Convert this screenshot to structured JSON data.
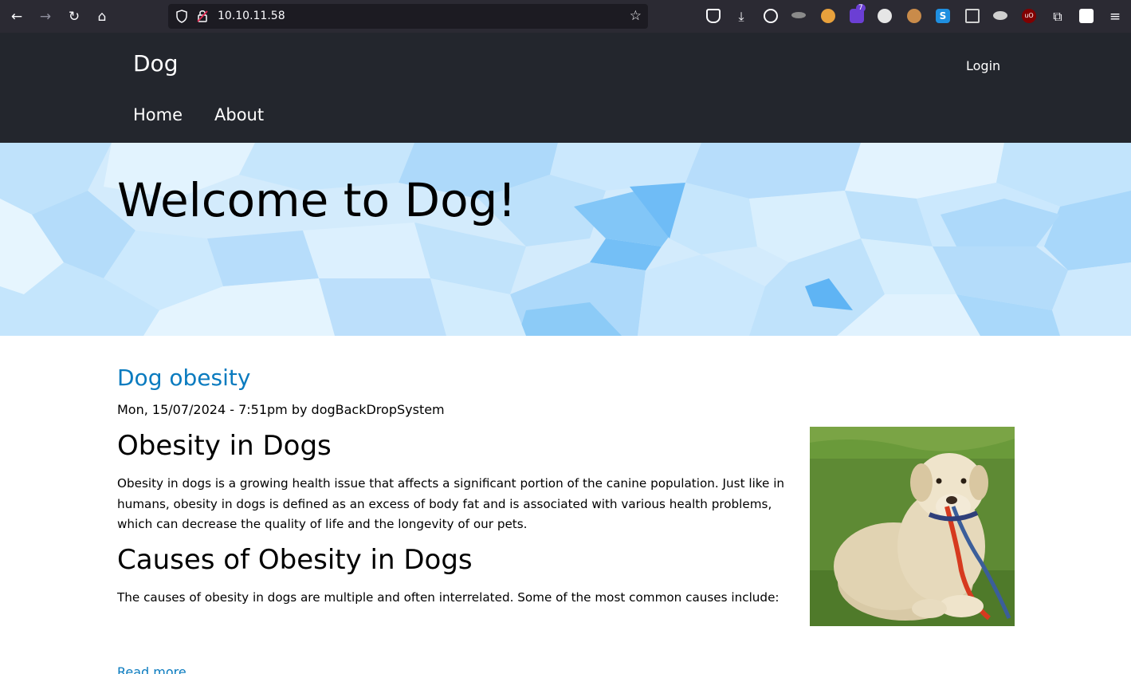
{
  "browser": {
    "url": "10.10.11.58",
    "extension_badge": "7",
    "extension_icons": [
      "pocket-icon",
      "download-icon",
      "account-icon",
      "hat-icon",
      "cookie-jar-icon",
      "puzzle-purple-icon",
      "mask-icon",
      "cookie-icon",
      "s-icon",
      "trash-icon",
      "ufo-icon",
      "ublock-icon",
      "extensions-icon",
      "search-ext-icon",
      "menu-icon"
    ]
  },
  "site": {
    "name": "Dog",
    "login_label": "Login",
    "nav": [
      "Home",
      "About"
    ]
  },
  "hero": {
    "title": "Welcome to Dog!"
  },
  "article": {
    "title": "Dog obesity",
    "meta": "Mon, 15/07/2024 - 7:51pm by dogBackDropSystem",
    "heading_1": "Obesity in Dogs",
    "paragraph_1": "Obesity in dogs is a growing health issue that affects a significant portion of the canine population. Just like in humans, obesity in dogs is defined as an excess of body fat and is associated with various health problems, which can decrease the quality of life and the longevity of our pets.",
    "heading_2": "Causes of Obesity in Dogs",
    "paragraph_2": "The causes of obesity in dogs are multiple and often interrelated. Some of the most common causes include:",
    "read_more": "Read more"
  },
  "colors": {
    "header_bg": "#23262d",
    "link": "#0a7bbf",
    "browser_bg": "#2b2a33"
  }
}
